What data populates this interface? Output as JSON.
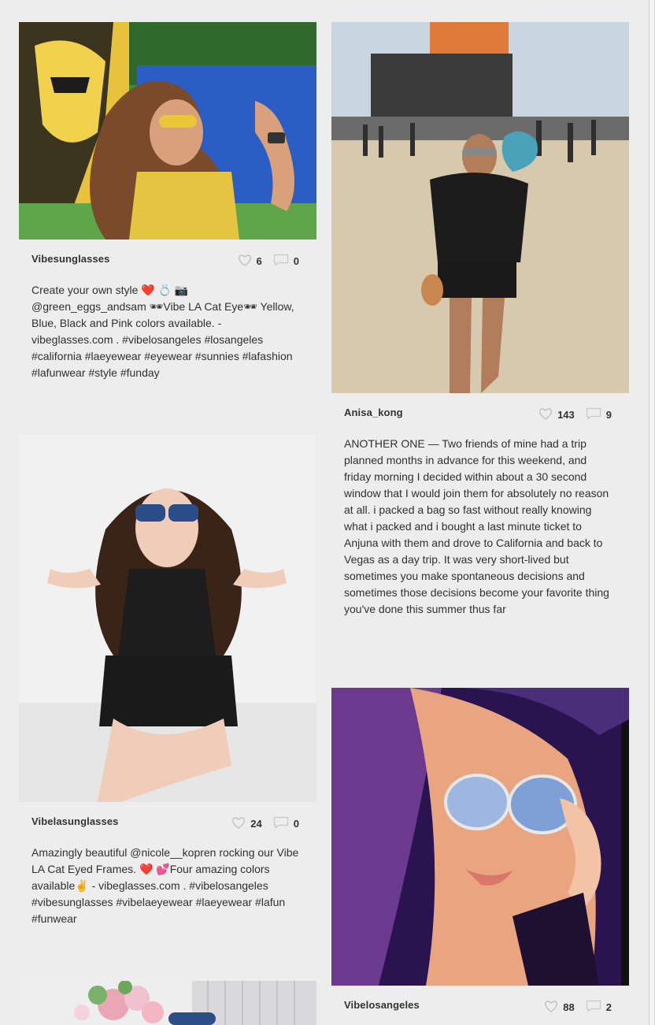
{
  "posts": [
    {
      "user": "Vibesunglasses",
      "likes": "6",
      "comments": "0",
      "caption": "Create your own style ❤️ 💍 📷 @green_eggs_andsam 🕶Vibe LA Cat Eye🕶  Yellow, Blue, Black and Pink colors available. - vibeglasses.com . #vibelosangeles #losangeles #california #laeyewear #eyewear #sunnies #lafashion #lafunwear #style #funday",
      "photo": "woman-yellow-top-sunglasses-mural"
    },
    {
      "user": "Anisa_kong",
      "likes": "143",
      "comments": "9",
      "caption": "ANOTHER ONE — Two friends of mine had a trip planned months in advance for this weekend, and friday morning I decided within about a 30 second window that I would join them for absolutely no reason at all. i packed a bag so fast without really knowing what i packed and i bought a last minute ticket to Anjuna with them and drove to California and back to Vegas as a day trip. It was very short-lived but sometimes you make spontaneous decisions and sometimes those decisions become your favorite thing you've done this summer thus far",
      "photo": "woman-beach-festival-stage"
    },
    {
      "user": "Vibelasunglasses",
      "likes": "24",
      "comments": "0",
      "caption": "Amazingly beautiful @nicole__kopren  rocking our Vibe LA Cat Eyed Frames. ❤️ 💕Four amazing colors available✌ - vibeglasses.com . #vibelosangeles #vibesunglasses #vibelaeyewear #laeyewear #lafun #funwear",
      "photo": "woman-black-outfit-blue-sunglasses"
    },
    {
      "user": "Vibelosangeles",
      "likes": "88",
      "comments": "2",
      "caption": "",
      "photo": "woman-mirrored-sunglasses-car-selfie"
    },
    {
      "user": "",
      "likes": "",
      "comments": "",
      "caption": "",
      "photo": "flowers-cake-partial"
    }
  ]
}
